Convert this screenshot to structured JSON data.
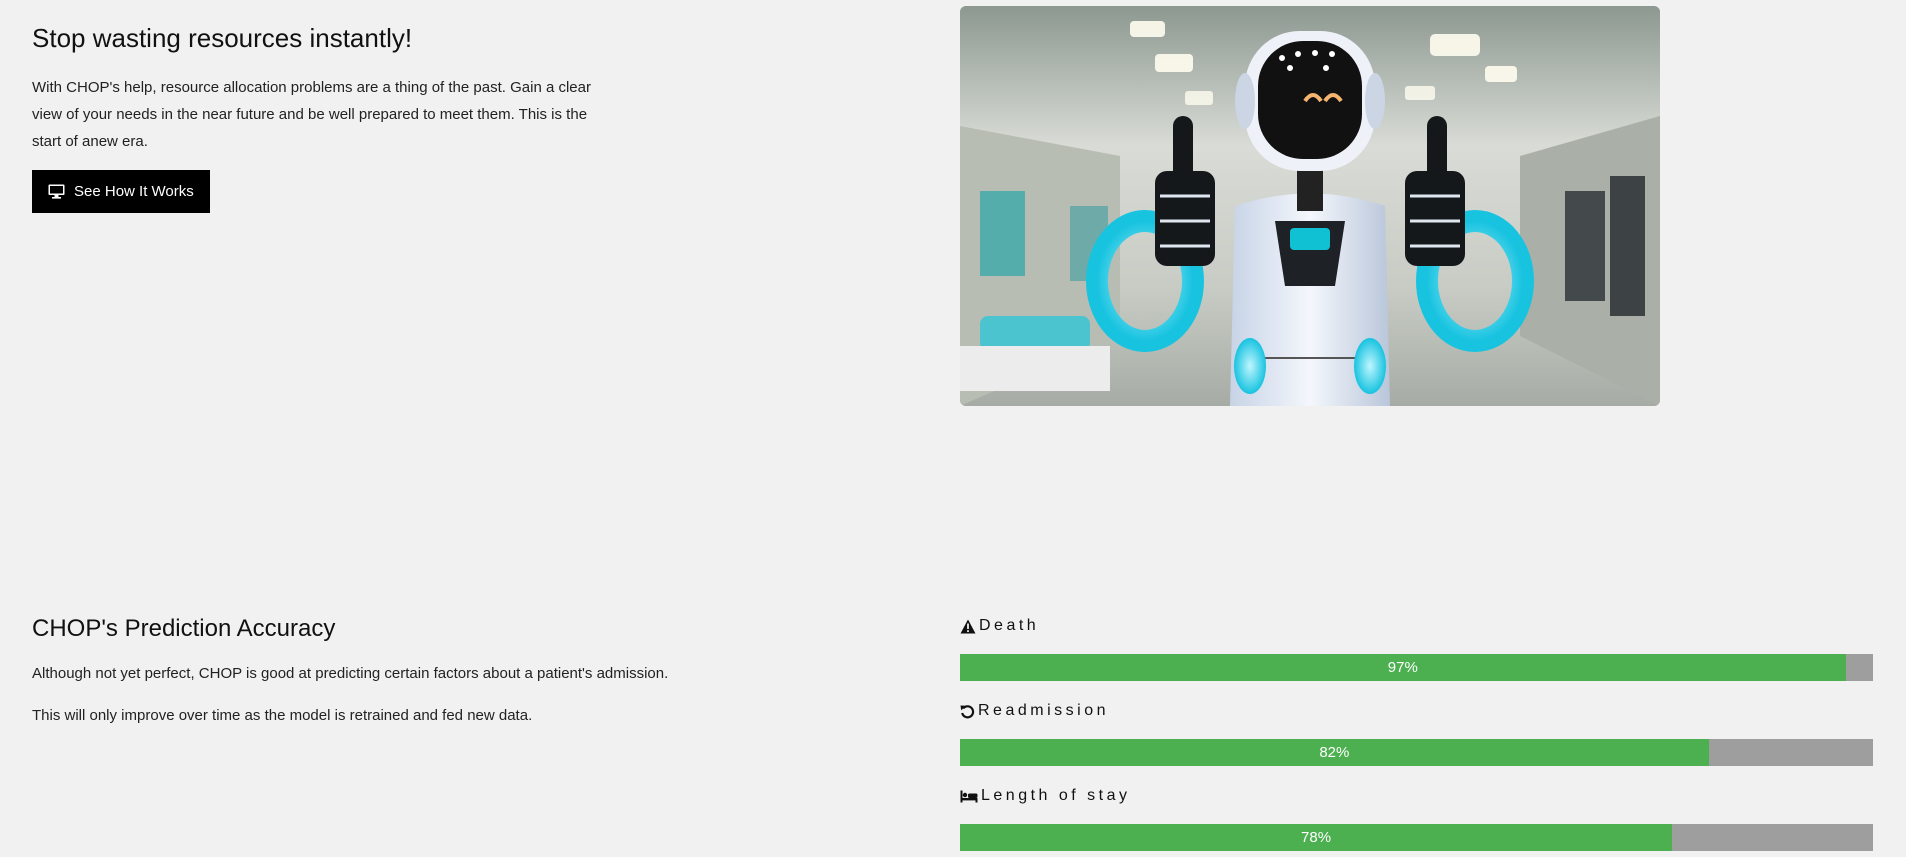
{
  "hero": {
    "title": "Stop wasting resources instantly!",
    "text": "With CHOP's help, resource allocation problems are a thing of the past. Gain a clear view of your needs in the near future and be well prepared to meet them. This is the start of anew era.",
    "button_label": "See How It Works",
    "button_icon": "desktop-icon",
    "image_subject": "robot-thumbs-up-hospital"
  },
  "accuracy": {
    "title": "CHOP's Prediction Accuracy",
    "paragraph_1": "Although not yet perfect, CHOP is good at predicting certain factors about a patient's admission.",
    "paragraph_2": "This will only improve over time as the model is retrained and fed new data.",
    "metrics": [
      {
        "label": "Death",
        "icon": "warning-icon",
        "percent": 97,
        "value_text": "97%"
      },
      {
        "label": "Readmission",
        "icon": "refresh-icon",
        "percent": 82,
        "value_text": "82%"
      },
      {
        "label": "Length of stay",
        "icon": "bed-icon",
        "percent": 78,
        "value_text": "78%"
      }
    ]
  },
  "colors": {
    "background": "#f1f1f1",
    "bar_fill": "#4caf50",
    "bar_track": "#9e9e9e",
    "button_bg": "#000000"
  }
}
